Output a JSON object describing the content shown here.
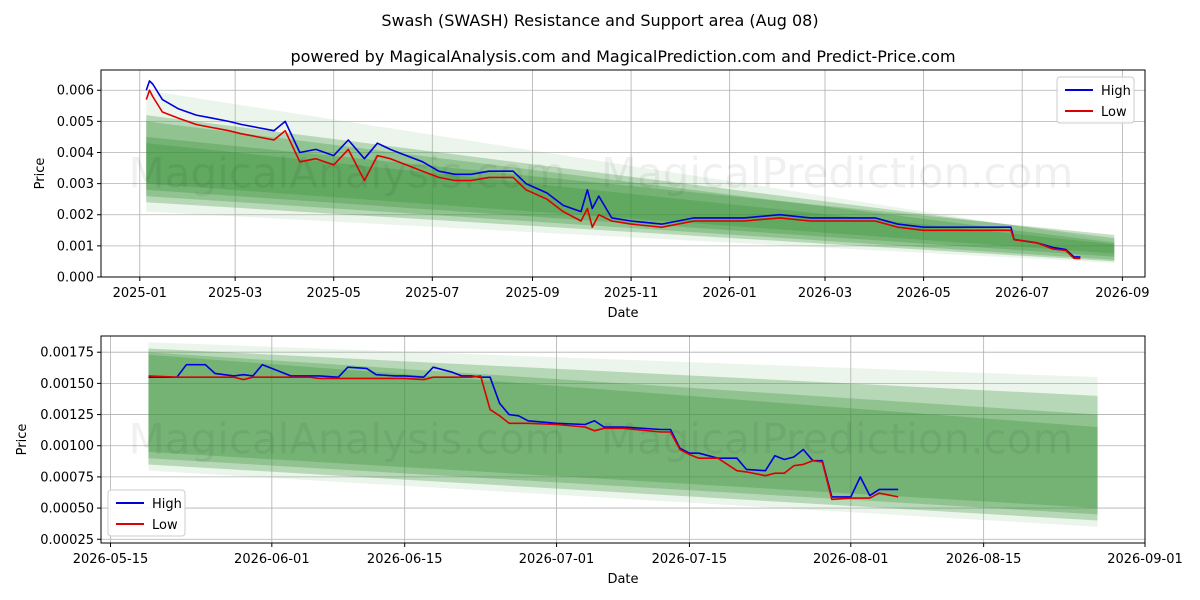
{
  "figure": {
    "title": "Swash (SWASH) Resistance and Support area (Aug 08)",
    "subtitle": "powered by MagicalAnalysis.com and MagicalPrediction.com and Predict-Price.com",
    "watermark_left": "MagicalAnalysis.com",
    "watermark_right": "MagicalPrediction.com"
  },
  "colors": {
    "high": "#0000dd",
    "low": "#dd0000",
    "band": "#2e8b2e",
    "band_light": "#8fc98f",
    "grid": "#b0b0b0"
  },
  "chart_data": [
    {
      "type": "line",
      "xlabel": "Date",
      "ylabel": "Price",
      "xlim": [
        "2024-12-08",
        "2026-09-15"
      ],
      "ylim": [
        0.0,
        0.00665
      ],
      "x_ticks": [
        "2025-01",
        "2025-03",
        "2025-05",
        "2025-07",
        "2025-09",
        "2025-11",
        "2026-01",
        "2026-03",
        "2026-05",
        "2026-07",
        "2026-09"
      ],
      "x_tick_dates": [
        "2025-01-01",
        "2025-03-01",
        "2025-05-01",
        "2025-07-01",
        "2025-09-01",
        "2025-11-01",
        "2026-01-01",
        "2026-03-01",
        "2026-05-01",
        "2026-07-01",
        "2026-09-01"
      ],
      "y_ticks": [
        0.0,
        0.001,
        0.002,
        0.003,
        0.004,
        0.005,
        0.006
      ],
      "y_tick_labels": [
        "0.000",
        "0.001",
        "0.002",
        "0.003",
        "0.004",
        "0.005",
        "0.006"
      ],
      "grid": true,
      "legend": {
        "position": "top-right",
        "entries": [
          "High",
          "Low"
        ]
      },
      "bands": [
        {
          "start": "2025-01-05",
          "end": "2026-08-27",
          "upper": [
            0.006,
            0.00115
          ],
          "lower": [
            0.0021,
            0.00045
          ]
        },
        {
          "start": "2025-01-05",
          "end": "2026-08-27",
          "upper": [
            0.0052,
            0.00125
          ],
          "lower": [
            0.0024,
            0.0005
          ]
        },
        {
          "start": "2025-01-05",
          "end": "2026-08-27",
          "upper": [
            0.0045,
            0.00135
          ],
          "lower": [
            0.0026,
            0.00055
          ]
        },
        {
          "start": "2025-01-05",
          "end": "2026-08-27",
          "upper": [
            0.005,
            0.0011
          ],
          "lower": [
            0.0028,
            0.00065
          ]
        },
        {
          "start": "2025-01-05",
          "end": "2026-08-27",
          "upper": [
            0.0043,
            0.00105
          ],
          "lower": [
            0.003,
            0.00075
          ]
        }
      ],
      "series": [
        {
          "name": "High",
          "x": [
            "2025-01-05",
            "2025-01-07",
            "2025-01-09",
            "2025-01-15",
            "2025-01-25",
            "2025-02-05",
            "2025-02-15",
            "2025-02-25",
            "2025-03-05",
            "2025-03-15",
            "2025-03-25",
            "2025-04-01",
            "2025-04-10",
            "2025-04-20",
            "2025-05-01",
            "2025-05-10",
            "2025-05-20",
            "2025-05-28",
            "2025-06-05",
            "2025-06-15",
            "2025-06-25",
            "2025-07-05",
            "2025-07-15",
            "2025-07-25",
            "2025-08-05",
            "2025-08-20",
            "2025-08-28",
            "2025-09-10",
            "2025-09-20",
            "2025-10-01",
            "2025-10-05",
            "2025-10-08",
            "2025-10-12",
            "2025-10-20",
            "2025-11-01",
            "2025-11-20",
            "2025-12-10",
            "2025-12-25",
            "2026-01-10",
            "2026-02-01",
            "2026-02-20",
            "2026-03-10",
            "2026-04-01",
            "2026-04-15",
            "2026-05-01",
            "2026-05-20",
            "2026-06-10",
            "2026-06-24",
            "2026-06-26",
            "2026-07-10",
            "2026-07-20",
            "2026-07-28",
            "2026-08-02",
            "2026-08-06"
          ],
          "values": [
            0.006,
            0.0063,
            0.0062,
            0.0057,
            0.0054,
            0.0052,
            0.0051,
            0.005,
            0.0049,
            0.0048,
            0.0047,
            0.005,
            0.004,
            0.0041,
            0.0039,
            0.0044,
            0.0038,
            0.0043,
            0.0041,
            0.0039,
            0.0037,
            0.0034,
            0.0033,
            0.0033,
            0.0034,
            0.0034,
            0.003,
            0.0027,
            0.0023,
            0.0021,
            0.0028,
            0.0022,
            0.0026,
            0.0019,
            0.0018,
            0.0017,
            0.0019,
            0.0019,
            0.0019,
            0.002,
            0.0019,
            0.0019,
            0.0019,
            0.0017,
            0.0016,
            0.0016,
            0.0016,
            0.0016,
            0.0012,
            0.0011,
            0.00095,
            0.00088,
            0.00065,
            0.00064
          ]
        },
        {
          "name": "Low",
          "x": [
            "2025-01-05",
            "2025-01-07",
            "2025-01-09",
            "2025-01-15",
            "2025-01-25",
            "2025-02-05",
            "2025-02-15",
            "2025-02-25",
            "2025-03-05",
            "2025-03-15",
            "2025-03-25",
            "2025-04-01",
            "2025-04-10",
            "2025-04-20",
            "2025-05-01",
            "2025-05-10",
            "2025-05-20",
            "2025-05-28",
            "2025-06-05",
            "2025-06-15",
            "2025-06-25",
            "2025-07-05",
            "2025-07-15",
            "2025-07-25",
            "2025-08-05",
            "2025-08-20",
            "2025-08-28",
            "2025-09-10",
            "2025-09-20",
            "2025-10-01",
            "2025-10-05",
            "2025-10-08",
            "2025-10-12",
            "2025-10-20",
            "2025-11-01",
            "2025-11-20",
            "2025-12-10",
            "2025-12-25",
            "2026-01-10",
            "2026-02-01",
            "2026-02-20",
            "2026-03-10",
            "2026-04-01",
            "2026-04-15",
            "2026-05-01",
            "2026-05-20",
            "2026-06-10",
            "2026-06-24",
            "2026-06-26",
            "2026-07-10",
            "2026-07-20",
            "2026-07-28",
            "2026-08-02",
            "2026-08-06"
          ],
          "values": [
            0.0057,
            0.006,
            0.0058,
            0.0053,
            0.0051,
            0.0049,
            0.0048,
            0.0047,
            0.0046,
            0.0045,
            0.0044,
            0.0047,
            0.0037,
            0.0038,
            0.0036,
            0.0041,
            0.0031,
            0.0039,
            0.0038,
            0.0036,
            0.0034,
            0.0032,
            0.0031,
            0.0031,
            0.0032,
            0.0032,
            0.0028,
            0.0025,
            0.0021,
            0.0018,
            0.0022,
            0.0016,
            0.002,
            0.0018,
            0.0017,
            0.0016,
            0.0018,
            0.0018,
            0.0018,
            0.0019,
            0.0018,
            0.0018,
            0.0018,
            0.0016,
            0.0015,
            0.0015,
            0.0015,
            0.0015,
            0.0012,
            0.0011,
            0.0009,
            0.00085,
            0.0006,
            0.00059
          ]
        }
      ]
    },
    {
      "type": "line",
      "xlabel": "Date",
      "ylabel": "Price",
      "xlim": [
        "2026-05-14",
        "2026-09-01"
      ],
      "ylim": [
        0.00022,
        0.00188
      ],
      "x_ticks": [
        "2026-05-15",
        "2026-06-01",
        "2026-06-15",
        "2026-07-01",
        "2026-07-15",
        "2026-08-01",
        "2026-08-15",
        "2026-09-01"
      ],
      "x_tick_dates": [
        "2026-05-15",
        "2026-06-01",
        "2026-06-15",
        "2026-07-01",
        "2026-07-15",
        "2026-08-01",
        "2026-08-15",
        "2026-09-01"
      ],
      "y_ticks": [
        0.00025,
        0.0005,
        0.00075,
        0.001,
        0.00125,
        0.0015,
        0.00175
      ],
      "y_tick_labels": [
        "0.00025",
        "0.00050",
        "0.00075",
        "0.00100",
        "0.00125",
        "0.00150",
        "0.00175"
      ],
      "grid": true,
      "legend": {
        "position": "bottom-left",
        "entries": [
          "High",
          "Low"
        ]
      },
      "bands": [
        {
          "start": "2026-05-19",
          "end": "2026-08-27",
          "upper": [
            0.00183,
            0.00155
          ],
          "lower": [
            0.0008,
            0.00035
          ]
        },
        {
          "start": "2026-05-19",
          "end": "2026-08-27",
          "upper": [
            0.00178,
            0.0014
          ],
          "lower": [
            0.00085,
            0.0004
          ]
        },
        {
          "start": "2026-05-19",
          "end": "2026-08-27",
          "upper": [
            0.00175,
            0.00125
          ],
          "lower": [
            0.0009,
            0.00045
          ]
        },
        {
          "start": "2026-05-19",
          "end": "2026-08-27",
          "upper": [
            0.00173,
            0.00115
          ],
          "lower": [
            0.00095,
            0.0005
          ]
        }
      ],
      "series": [
        {
          "name": "High",
          "x": [
            "2026-05-19",
            "2026-05-22",
            "2026-05-23",
            "2026-05-25",
            "2026-05-26",
            "2026-05-28",
            "2026-05-29",
            "2026-05-30",
            "2026-05-31",
            "2026-06-01",
            "2026-06-03",
            "2026-06-05",
            "2026-06-06",
            "2026-06-08",
            "2026-06-09",
            "2026-06-11",
            "2026-06-12",
            "2026-06-14",
            "2026-06-15",
            "2026-06-17",
            "2026-06-18",
            "2026-06-20",
            "2026-06-21",
            "2026-06-22",
            "2026-06-23",
            "2026-06-24",
            "2026-06-25",
            "2026-06-26",
            "2026-06-27",
            "2026-06-28",
            "2026-07-01",
            "2026-07-04",
            "2026-07-05",
            "2026-07-06",
            "2026-07-08",
            "2026-07-12",
            "2026-07-13",
            "2026-07-14",
            "2026-07-15",
            "2026-07-16",
            "2026-07-18",
            "2026-07-20",
            "2026-07-21",
            "2026-07-23",
            "2026-07-24",
            "2026-07-25",
            "2026-07-26",
            "2026-07-27",
            "2026-07-28",
            "2026-07-29",
            "2026-07-30",
            "2026-08-01",
            "2026-08-02",
            "2026-08-03",
            "2026-08-04",
            "2026-08-06"
          ],
          "values": [
            0.00155,
            0.00155,
            0.00165,
            0.00165,
            0.00158,
            0.00156,
            0.00157,
            0.00156,
            0.00165,
            0.00162,
            0.00156,
            0.00156,
            0.00156,
            0.00155,
            0.00163,
            0.00162,
            0.00157,
            0.00156,
            0.00156,
            0.00155,
            0.00163,
            0.00159,
            0.00156,
            0.00156,
            0.00155,
            0.00155,
            0.00134,
            0.00125,
            0.00124,
            0.0012,
            0.00118,
            0.00117,
            0.0012,
            0.00115,
            0.00115,
            0.00113,
            0.00113,
            0.00098,
            0.00094,
            0.00094,
            0.0009,
            0.0009,
            0.00081,
            0.0008,
            0.00092,
            0.00089,
            0.00091,
            0.00097,
            0.00088,
            0.00088,
            0.00059,
            0.00059,
            0.00075,
            0.0006,
            0.00065,
            0.00065
          ]
        },
        {
          "name": "Low",
          "x": [
            "2026-05-19",
            "2026-05-22",
            "2026-05-23",
            "2026-05-25",
            "2026-05-26",
            "2026-05-28",
            "2026-05-29",
            "2026-05-30",
            "2026-05-31",
            "2026-06-01",
            "2026-06-03",
            "2026-06-05",
            "2026-06-06",
            "2026-06-08",
            "2026-06-09",
            "2026-06-11",
            "2026-06-12",
            "2026-06-14",
            "2026-06-15",
            "2026-06-17",
            "2026-06-18",
            "2026-06-20",
            "2026-06-21",
            "2026-06-22",
            "2026-06-23",
            "2026-06-24",
            "2026-06-25",
            "2026-06-26",
            "2026-06-27",
            "2026-06-28",
            "2026-07-01",
            "2026-07-04",
            "2026-07-05",
            "2026-07-06",
            "2026-07-08",
            "2026-07-12",
            "2026-07-13",
            "2026-07-14",
            "2026-07-15",
            "2026-07-16",
            "2026-07-18",
            "2026-07-20",
            "2026-07-21",
            "2026-07-23",
            "2026-07-24",
            "2026-07-25",
            "2026-07-26",
            "2026-07-27",
            "2026-07-28",
            "2026-07-29",
            "2026-07-30",
            "2026-08-01",
            "2026-08-02",
            "2026-08-03",
            "2026-08-04",
            "2026-08-06"
          ],
          "values": [
            0.00156,
            0.00155,
            0.00155,
            0.00155,
            0.00155,
            0.00155,
            0.00153,
            0.00155,
            0.00155,
            0.00155,
            0.00155,
            0.00155,
            0.00154,
            0.00154,
            0.00154,
            0.00154,
            0.00154,
            0.00154,
            0.00154,
            0.00153,
            0.00155,
            0.00155,
            0.00155,
            0.00155,
            0.00156,
            0.00129,
            0.00124,
            0.00118,
            0.00118,
            0.00118,
            0.00117,
            0.00115,
            0.00112,
            0.00114,
            0.00114,
            0.00111,
            0.00111,
            0.00097,
            0.00093,
            0.0009,
            0.0009,
            0.0008,
            0.00079,
            0.00076,
            0.00078,
            0.00078,
            0.00084,
            0.00085,
            0.00088,
            0.00087,
            0.00057,
            0.00058,
            0.00058,
            0.00058,
            0.00062,
            0.00059
          ]
        }
      ]
    }
  ]
}
